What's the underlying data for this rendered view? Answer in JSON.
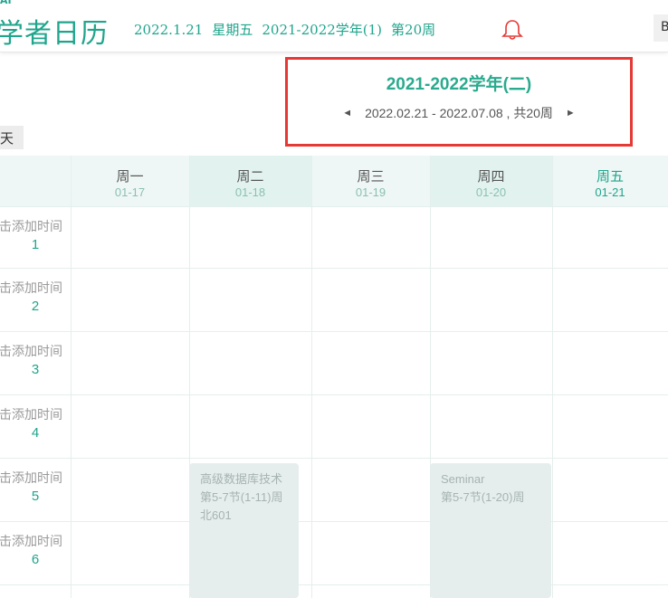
{
  "header": {
    "app_title": "学者日历",
    "mini_logo": "AI",
    "date": "2022.1.21",
    "weekday": "星期五",
    "term": "2021-2022学年(1)",
    "week": "第20周",
    "bell_icon": "bell-icon",
    "right_button_label": "B"
  },
  "today_button": "天",
  "term_panel": {
    "title": "2021-2022学年(二)",
    "range": "2022.02.21 - 2022.07.08 , 共20周",
    "prev_icon": "◄",
    "next_icon": "►"
  },
  "columns": [
    {
      "day": "周一",
      "date": "01-17",
      "today": false
    },
    {
      "day": "周二",
      "date": "01-18",
      "today": false
    },
    {
      "day": "周三",
      "date": "01-19",
      "today": false
    },
    {
      "day": "周四",
      "date": "01-20",
      "today": false
    },
    {
      "day": "周五",
      "date": "01-21",
      "today": true
    }
  ],
  "periods": [
    {
      "add_label": "击添加时间",
      "num": "1"
    },
    {
      "add_label": "击添加时间",
      "num": "2"
    },
    {
      "add_label": "击添加时间",
      "num": "3"
    },
    {
      "add_label": "击添加时间",
      "num": "4"
    },
    {
      "add_label": "击添加时间",
      "num": "5"
    },
    {
      "add_label": "击添加时间",
      "num": "6"
    }
  ],
  "courses": [
    {
      "name": "高级数据库技术",
      "time": "第5-7节(1-11)周",
      "room": "北601"
    },
    {
      "name": "Seminar",
      "time": "第5-7节(1-20)周",
      "room": ""
    }
  ],
  "colors": {
    "accent": "#1fa58c",
    "highlight_border": "#e53935",
    "course_bg": "#e6eeed"
  }
}
